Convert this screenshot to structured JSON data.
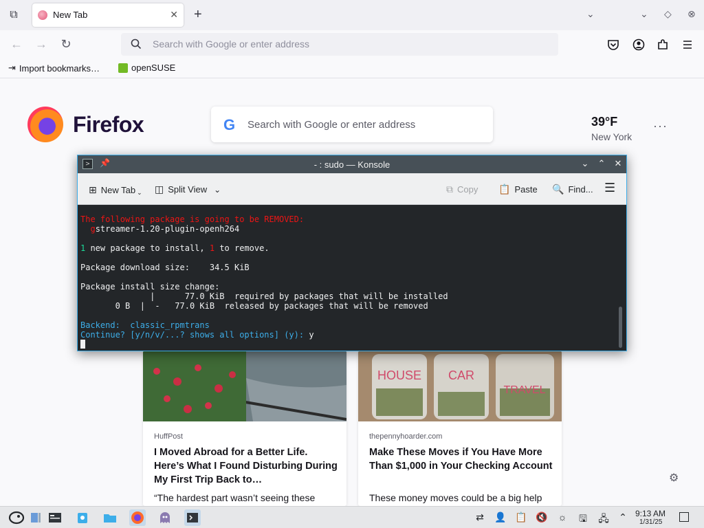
{
  "browser": {
    "tab_title": "New Tab",
    "tab_close": "✕",
    "new_tab_plus": "+",
    "url_placeholder": "Search with Google or enter address",
    "bookmarks": [
      {
        "label": "Import bookmarks…",
        "icon": "import-icon"
      },
      {
        "label": "openSUSE",
        "icon": "opensuse-icon"
      }
    ]
  },
  "newtab": {
    "brand": "Firefox",
    "search_placeholder": "Search with Google or enter address",
    "google_letter": "G",
    "weather_temp": "39°F",
    "weather_city": "New York",
    "more": "···",
    "cards": [
      {
        "source": "HuffPost",
        "headline": "I Moved Abroad for a Better Life. Here’s What I Found Disturbing During My First Trip Back to…",
        "excerpt": "“The hardest part wasn’t seeing these"
      },
      {
        "source": "thepennyhoarder.com",
        "headline": "Make These Moves if You Have More Than $1,000 in Your Checking Account",
        "excerpt": "These money moves could be a big help",
        "jar_labels": [
          "HOUSE",
          "CAR",
          "TRAVEL"
        ]
      }
    ]
  },
  "konsole": {
    "title": "- : sudo — Konsole",
    "toolbar": {
      "new_tab": "New Tab",
      "split_view": "Split View",
      "copy": "Copy",
      "paste": "Paste",
      "find": "Find..."
    },
    "terminal": {
      "removed_header": "The following package is going to be REMOVED:",
      "removed_pkg_first": "g",
      "removed_pkg_rest": "streamer-1.20-plugin-openh264",
      "summary_new_count": "1",
      "summary_new_text": " new package to install, ",
      "summary_remove_count": "1",
      "summary_remove_text": " to remove.",
      "download_size": "Package download size:    34.5 KiB",
      "install_size_header": "Package install size change:",
      "install_line1": "              |      77.0 KiB  required by packages that will be installed",
      "install_line2": "       0 B  |  -   77.0 KiB  released by packages that will be removed",
      "backend": "Backend:  classic_rpmtrans",
      "prompt": "Continue? [y/n/v/...? shows all options] (y): ",
      "answer": "y"
    }
  },
  "taskbar": {
    "time": "9:13 AM",
    "date": "1/31/25"
  },
  "colors": {
    "accent": "#3daee9",
    "terminal_bg": "#232629",
    "terminal_red": "#ed1515",
    "terminal_green": "#1cdc9a",
    "terminal_blue": "#3daee9"
  }
}
